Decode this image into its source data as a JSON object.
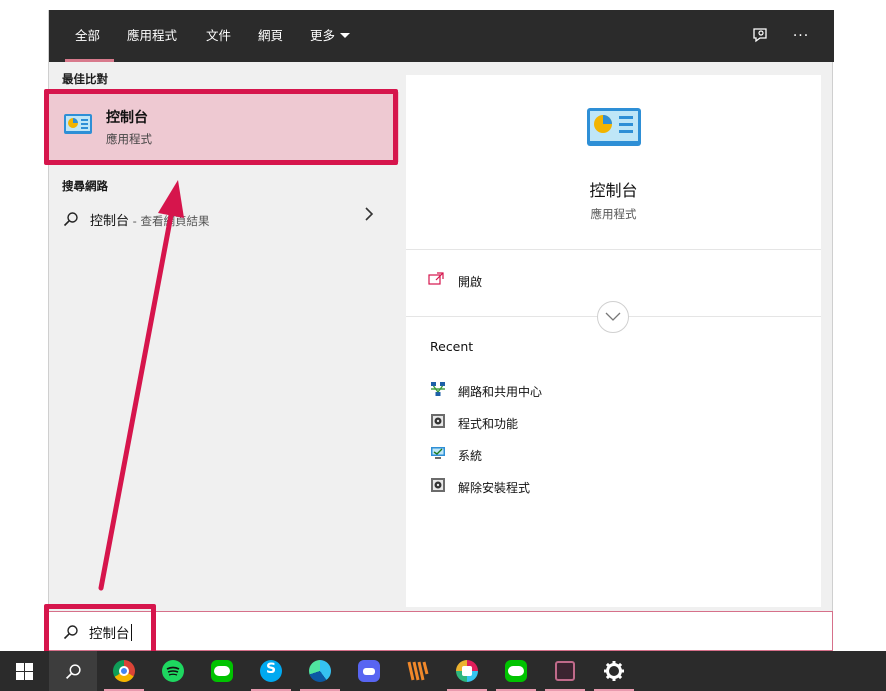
{
  "tabs": [
    {
      "label": "全部",
      "active": true
    },
    {
      "label": "應用程式"
    },
    {
      "label": "文件"
    },
    {
      "label": "網頁"
    },
    {
      "label": "更多"
    }
  ],
  "left": {
    "best_match_heading": "最佳比對",
    "best_match": {
      "title": "控制台",
      "subtitle": "應用程式",
      "icon": "control-panel-icon"
    },
    "web_heading": "搜尋網路",
    "web_result": {
      "query": "控制台",
      "rest": " - 查看網頁結果"
    }
  },
  "detail": {
    "title": "控制台",
    "subtitle": "應用程式",
    "open_label": "開啟",
    "recent_heading": "Recent",
    "recent": [
      {
        "label": "網路和共用中心",
        "icon": "network-sharing-icon"
      },
      {
        "label": "程式和功能",
        "icon": "programs-features-icon"
      },
      {
        "label": "系統",
        "icon": "system-icon"
      },
      {
        "label": "解除安裝程式",
        "icon": "uninstall-program-icon"
      }
    ]
  },
  "search": {
    "value": "控制台"
  },
  "taskbar": [
    "windows-start-icon",
    "search-icon",
    "chrome-icon",
    "spotify-icon",
    "line-icon",
    "skype-icon",
    "edge-icon",
    "discord-icon",
    "winamp-icon",
    "slack-icon",
    "line-icon",
    "onenote-icon",
    "settings-gear-icon"
  ],
  "colors": {
    "accent": "#d6154c",
    "selection": "#eec9d2",
    "tab_underline": "#d87a8c",
    "topbar": "#2b2b2b"
  }
}
